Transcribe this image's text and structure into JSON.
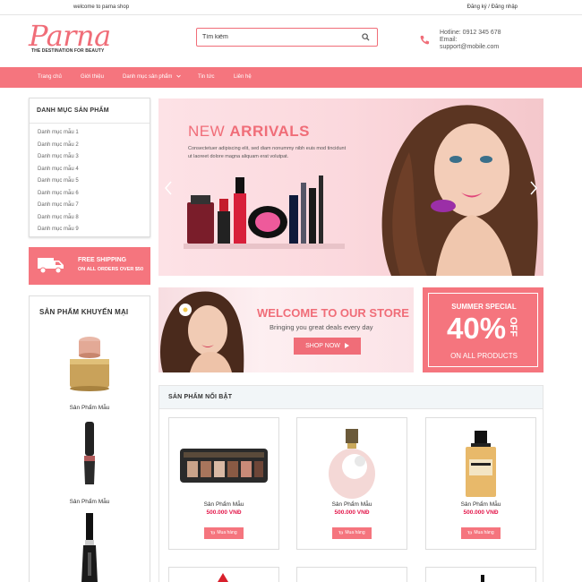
{
  "topbar": {
    "welcome": "welcome to parna shop",
    "register": "Đăng ký",
    "separator": " / ",
    "login": "Đăng nhập"
  },
  "header": {
    "logo": "Parna",
    "tagline": "THE DESTINATION FOR BEAUTY",
    "search_placeholder": "Tìm kiếm",
    "hotline": "Hotline: 0912 345 678",
    "email_label": "Email:",
    "email": "support@mobile.com"
  },
  "nav": {
    "items": [
      "Trang chủ",
      "Giới thiệu",
      "Danh mục sản phẩm",
      "Tin tức",
      "Liên hệ"
    ]
  },
  "sidebar": {
    "categories_title": "DANH MỤC SẢN PHẨM",
    "categories": [
      "Danh mục mẫu 1",
      "Danh mục mẫu 2",
      "Danh mục mẫu 3",
      "Danh mục mẫu 4",
      "Danh mục mẫu 5",
      "Danh mục mẫu 6",
      "Danh mục mẫu 7",
      "Danh mục mẫu 8",
      "Danh mục mẫu 9"
    ],
    "shipping_line1": "FREE SHIPPING",
    "shipping_line2": "ON ALL ORDERS OVER $50",
    "promo_title": "SẢN PHẨM KHUYẾN MẠI",
    "promo_products": [
      "Sản Phẩm Mẫu",
      "Sản Phẩm Mẫu"
    ]
  },
  "slider": {
    "headline_light": "NEW ",
    "headline_bold": "ARRIVALS",
    "text": "Consectetuer adipiscing elit, sed diam nonummy nibh euis mod tincidunt ut laoreet dolore magna aliquam erat volutpat."
  },
  "welcome_banner": {
    "title": "WELCOME TO OUR STORE",
    "subtitle": "Bringing you great deals every day",
    "button": "SHOP NOW"
  },
  "summer_banner": {
    "title": "SUMMER SPECIAL",
    "percent": "40%",
    "off": "OFF",
    "footer": "ON ALL PRODUCTS"
  },
  "featured": {
    "title": "SẢN PHẨM NỔI BẬT",
    "products": [
      {
        "name": "Sản Phẩm Mẫu",
        "price": "500.000 VNĐ",
        "button": "Mua hàng"
      },
      {
        "name": "Sản Phẩm Mẫu",
        "price": "500.000 VNĐ",
        "button": "Mua hàng"
      },
      {
        "name": "Sản Phẩm Mẫu",
        "price": "500.000 VNĐ",
        "button": "Mua hàng"
      }
    ]
  },
  "colors": {
    "accent": "#f5757e",
    "logo": "#f06d78",
    "price": "#e3184b"
  }
}
